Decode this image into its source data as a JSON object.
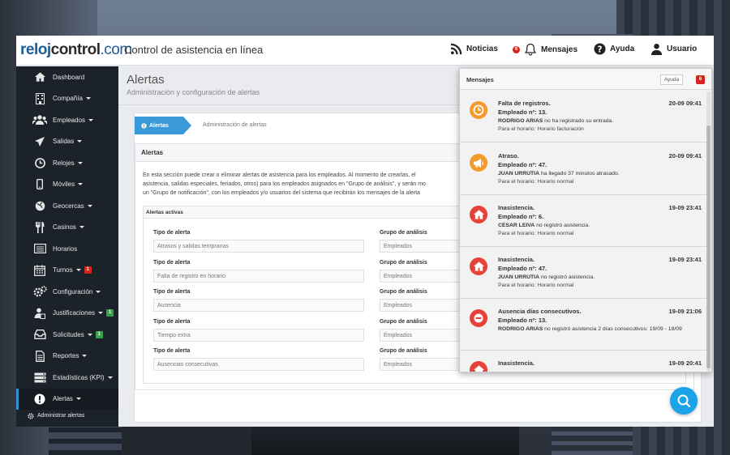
{
  "header": {
    "logo_part1": "reloj",
    "logo_part2": "control",
    "logo_part3": ".com",
    "tagline": "Control de asistencia en línea",
    "nav": {
      "noticias": "Noticias",
      "mensajes": "Mensajes",
      "mensajes_badge": "6",
      "ayuda": "Ayuda",
      "usuario": "Usuario"
    }
  },
  "sidebar": {
    "items": [
      {
        "label": "Dashboard",
        "icon": "home-icon"
      },
      {
        "label": "Compañía",
        "icon": "building-icon"
      },
      {
        "label": "Empleados",
        "icon": "users-icon"
      },
      {
        "label": "Salidas",
        "icon": "plane-icon"
      },
      {
        "label": "Relojes",
        "icon": "clock-icon"
      },
      {
        "label": "Móviles",
        "icon": "mobile-icon"
      },
      {
        "label": "Geocercas",
        "icon": "globe-icon"
      },
      {
        "label": "Casinos",
        "icon": "cutlery-icon"
      },
      {
        "label": "Horarios",
        "icon": "list-icon"
      },
      {
        "label": "Turnos",
        "icon": "calendar-icon",
        "badge": "1"
      },
      {
        "label": "Configuración",
        "icon": "cogs-icon"
      },
      {
        "label": "Justificaciones",
        "icon": "user-doc-icon",
        "badge": "1"
      },
      {
        "label": "Solicitudes",
        "icon": "inbox-icon",
        "badge": "1"
      },
      {
        "label": "Reportes",
        "icon": "file-icon"
      },
      {
        "label": "Estadísticas (KPI)",
        "icon": "server-icon"
      },
      {
        "label": "Alertas",
        "icon": "exclamation-icon"
      }
    ],
    "subitem": "Administrar alertas"
  },
  "main": {
    "title": "Alertas",
    "subtitle": "Administración y configuración de alertas",
    "crumb_active": "Alertas",
    "crumb_next": "Administración de alertas",
    "panel_title": "Alertas",
    "panel_desc_1": "En esta sección puede crear o eliminar alertas de asistencia para los empleados. Al momento de crearlas, el",
    "panel_desc_2": "asistencia, salidas especiales, feriados, otros) para los empleados asignados en \"Grupo de análisis\", y serán mo",
    "panel_desc_3": "un \"Grupo de notificación\", con los empleados y/o usuarios del sistema que recibirán los mensajes de la alerta",
    "active_title": "Alertas activas",
    "type_label": "Tipo de alerta",
    "group_label": "Grupo de análisis",
    "alerts": [
      {
        "type": "Atrasos y salidas tempranas",
        "group": "Empleados"
      },
      {
        "type": "Falta de registro en horario",
        "group": "Empleados"
      },
      {
        "type": "Ausencia",
        "group": "Empleados"
      },
      {
        "type": "Tiempo extra",
        "group": "Empleados"
      },
      {
        "type": "Ausencias consecutivas",
        "group": "Empleados"
      }
    ]
  },
  "messages": {
    "title": "Mensajes",
    "help": "Ayuda",
    "count": "6",
    "items": [
      {
        "title": "Falta de registros.",
        "time": "20-09 09:41",
        "emp": "Empleado nº: 13.",
        "name": "RODRIGO ARIAS",
        "text": " no ha registrado su entrada.",
        "schedule": "Para el horario: Horario facturación",
        "icon": "clock-icon",
        "color": "#f39a2b"
      },
      {
        "title": "Atraso.",
        "time": "20-09 09:41",
        "emp": "Empleado nº: 47.",
        "name": "JUAN URRUTIA",
        "text": " ha llegado 37 minutos atrasado.",
        "schedule": "Para el horario: Horario normal",
        "icon": "megaphone-icon",
        "color": "#f39a2b"
      },
      {
        "title": "Inasistencia.",
        "time": "19-09 23:41",
        "emp": "Empleado nº: 6.",
        "name": "CESAR LEIVA",
        "text": " no registró asistencia.",
        "schedule": "Para el horario: Horario normal",
        "icon": "home-icon",
        "color": "#e8413a"
      },
      {
        "title": "Inasistencia.",
        "time": "19-09 23:41",
        "emp": "Empleado nº: 47.",
        "name": "JUAN URRUTIA",
        "text": " no registró asistencia.",
        "schedule": "Para el horario: Horario normal",
        "icon": "home-icon",
        "color": "#e8413a"
      },
      {
        "title": "Ausencia días consecutivos.",
        "time": "19-09 21:06",
        "emp": "Empleado nº: 13.",
        "name": "RODRIGO ARIAS",
        "text": " no registró asistencia 2 días consecutivos: 19/09 - 18/09",
        "schedule": "",
        "icon": "minus-circle-icon",
        "color": "#e8413a"
      },
      {
        "title": "Inasistencia.",
        "time": "19-09 20:41",
        "emp": "",
        "name": "",
        "text": "",
        "schedule": "",
        "icon": "home-icon",
        "color": "#e8413a"
      }
    ]
  },
  "colors": {
    "accent": "#3a9ad9",
    "brand": "#1c5d9c",
    "sidebar": "#1c2229",
    "fab": "#1aa3e8",
    "badge": "#d9241b"
  }
}
